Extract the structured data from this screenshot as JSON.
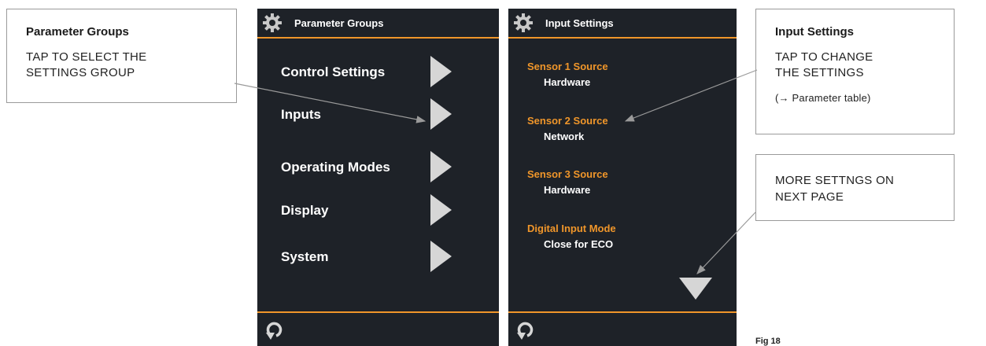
{
  "callouts": {
    "groups": {
      "title": "Parameter Groups",
      "body": "TAP TO SELECT THE\nSETTINGS GROUP"
    },
    "input": {
      "title": "Input Settings",
      "body": "TAP TO CHANGE\nTHE SETTINGS",
      "note": "(→  Parameter table)"
    },
    "more": {
      "body": "MORE SETTNGS ON\nNEXT PAGE"
    }
  },
  "screen_groups": {
    "title": "Parameter Groups",
    "items": [
      {
        "label": "Control Settings"
      },
      {
        "label": "Inputs"
      },
      {
        "label": "Operating Modes"
      },
      {
        "label": "Display"
      },
      {
        "label": "System"
      }
    ]
  },
  "screen_input": {
    "title": "Input Settings",
    "settings": [
      {
        "name": "Sensor 1 Source",
        "value": "Hardware"
      },
      {
        "name": "Sensor 2 Source",
        "value": "Network"
      },
      {
        "name": "Sensor 3 Source",
        "value": "Hardware"
      },
      {
        "name": "Digital Input Mode",
        "value": "Close for ECO"
      }
    ]
  },
  "figure_label": "Fig 18",
  "colors": {
    "screen_bg": "#1e2228",
    "accent": "#f0962a",
    "arrow": "#d6d6d6"
  },
  "icons": {
    "header": "gear-icon",
    "footer": "back-arrow-icon",
    "menu": "play-triangle-icon",
    "more": "triangle-down-icon"
  }
}
